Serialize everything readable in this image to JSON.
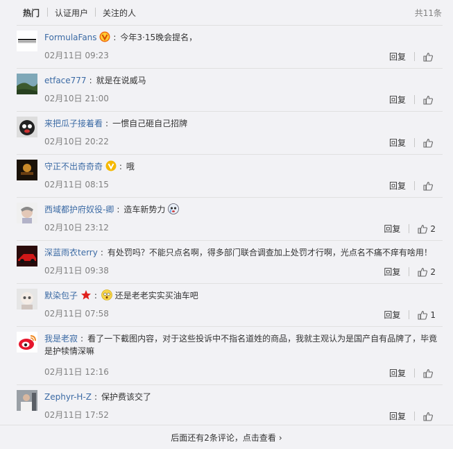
{
  "tabs": [
    {
      "label": "热门"
    },
    {
      "label": "认证用户"
    },
    {
      "label": "关注的人"
    }
  ],
  "total_label": "共11条",
  "reply_label": "回复",
  "comments": [
    {
      "user": "FormulaFans",
      "badge": "orange-v-badge",
      "text": "今年3·15晚会提名，",
      "time": "02月11日 09:23",
      "likes": ""
    },
    {
      "user": "etface777",
      "badge": "",
      "text": "就是在说威马",
      "time": "02月10日 21:00",
      "likes": ""
    },
    {
      "user": "来把瓜子接着看",
      "badge": "",
      "text": "一惯自己砸自己招牌",
      "time": "02月10日 20:22",
      "likes": ""
    },
    {
      "user": "守正不出奇奇奇",
      "badge": "yellow-v-badge",
      "text": "哦",
      "time": "02月11日 08:15",
      "likes": ""
    },
    {
      "user": "西域都护府奴役-卿",
      "badge": "",
      "text": "造车新势力",
      "time": "02月10日 23:12",
      "likes": "2"
    },
    {
      "user": "深蓝雨衣terry",
      "badge": "",
      "text": "有处罚吗？不能只点名啊，得多部门联合调查加上处罚才行啊，光点名不痛不痒有啥用！",
      "time": "02月11日 09:38",
      "likes": "2"
    },
    {
      "user": "默染包子",
      "badge": "red-star-badge",
      "text": "还是老老实实买油车吧",
      "time": "02月11日 07:58",
      "likes": "1"
    },
    {
      "user": "我是老寂",
      "badge": "",
      "text": "看了一下截图内容，对于这些投诉中不指名道姓的商品，我就主观认为是国产自有品牌了，毕竟是护犊情深嘛",
      "time": "02月11日 12:16",
      "likes": ""
    },
    {
      "user": "Zephyr-H-Z",
      "badge": "",
      "text": "保护费该交了",
      "time": "02月11日 17:52",
      "likes": ""
    }
  ],
  "more_label": "后面还有2条评论，点击查看",
  "colors": {
    "link": "#3b6aa4",
    "muted": "#808080",
    "bg": "#f2f2f5"
  }
}
